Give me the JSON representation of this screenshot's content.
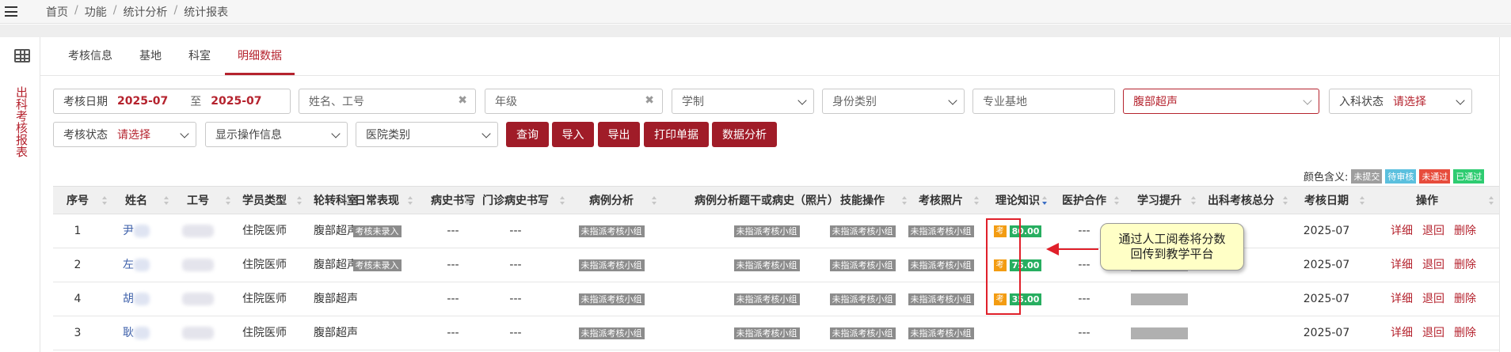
{
  "breadcrumb": [
    "首页",
    "功能",
    "统计分析",
    "统计报表"
  ],
  "breadcrumb_sep": "/",
  "side_title": "出科考核报表",
  "tabs": [
    "考核信息",
    "基地",
    "科室",
    "明细数据"
  ],
  "filters": {
    "date_label": "考核日期",
    "date_start": "2025-07",
    "date_to": "至",
    "date_end": "2025-07",
    "name_placeholder": "姓名、工号",
    "grade_placeholder": "年级",
    "schooling": "学制",
    "identity": "身份类别",
    "major_base": "专业基地",
    "dept": "腹部超声",
    "enroll_label": "入科状态",
    "enroll_value": "请选择",
    "exam_label": "考核状态",
    "exam_value": "请选择",
    "show_ops": "显示操作信息",
    "hospital_type": "医院类别"
  },
  "buttons": [
    "查询",
    "导入",
    "导出",
    "打印单据",
    "数据分析"
  ],
  "legend": {
    "title": "颜色含义:",
    "items": [
      {
        "label": "未提交",
        "color": "#9e9e9e"
      },
      {
        "label": "待审核",
        "color": "#5bc0de"
      },
      {
        "label": "未通过",
        "color": "#e74c3c"
      },
      {
        "label": "已通过",
        "color": "#2ecc71"
      }
    ]
  },
  "columns": [
    "序号",
    "姓名",
    "工号",
    "学员类型",
    "轮转科室",
    "日常表现",
    "病史书写",
    "门诊病史书写",
    "病例分析",
    "病例分析题干或病史（照片）",
    "技能操作",
    "考核照片",
    "理论知识",
    "医护合作",
    "学习提升",
    "出科考核总分",
    "考核日期",
    "操作"
  ],
  "rows": [
    {
      "no": "1",
      "name": "尹",
      "type": "住院医师",
      "dept": "腹部超声",
      "daily": "考核未录入",
      "history": "---",
      "outpatient": "---",
      "case": "未指派考核小组",
      "case_photo": "未指派考核小组",
      "skill": "未指派考核小组",
      "photo": "未指派考核小组",
      "kao": "考",
      "score": "80.00",
      "coop": "---",
      "date": "2025-07",
      "show_bar": false
    },
    {
      "no": "2",
      "name": "左",
      "type": "住院医师",
      "dept": "腹部超声",
      "daily": "考核未录入",
      "history": "---",
      "outpatient": "---",
      "case": "未指派考核小组",
      "case_photo": "未指派考核小组",
      "skill": "未指派考核小组",
      "photo": "未指派考核小组",
      "kao": "考",
      "score": "75.00",
      "coop": "---",
      "date": "2025-07",
      "show_bar": true
    },
    {
      "no": "4",
      "name": "胡",
      "type": "住院医师",
      "dept": "腹部超声",
      "daily": "",
      "history": "---",
      "outpatient": "---",
      "case": "未指派考核小组",
      "case_photo": "未指派考核小组",
      "skill": "未指派考核小组",
      "photo": "未指派考核小组",
      "kao": "考",
      "score": "35.00",
      "coop": "---",
      "date": "2025-07",
      "show_bar": true
    },
    {
      "no": "3",
      "name": "耿",
      "type": "住院医师",
      "dept": "腹部超声",
      "daily": "",
      "history": "---",
      "outpatient": "---",
      "case": "未指派考核小组",
      "case_photo": "未指派考核小组",
      "skill": "未指派考核小组",
      "photo": "未指派考核小组",
      "kao": "",
      "score": "",
      "coop": "---",
      "date": "2025-07",
      "show_bar": true
    }
  ],
  "actions": [
    "详细",
    "退回",
    "删除"
  ],
  "callout": [
    "通过人工阅卷将分数",
    "回传到教学平台"
  ]
}
